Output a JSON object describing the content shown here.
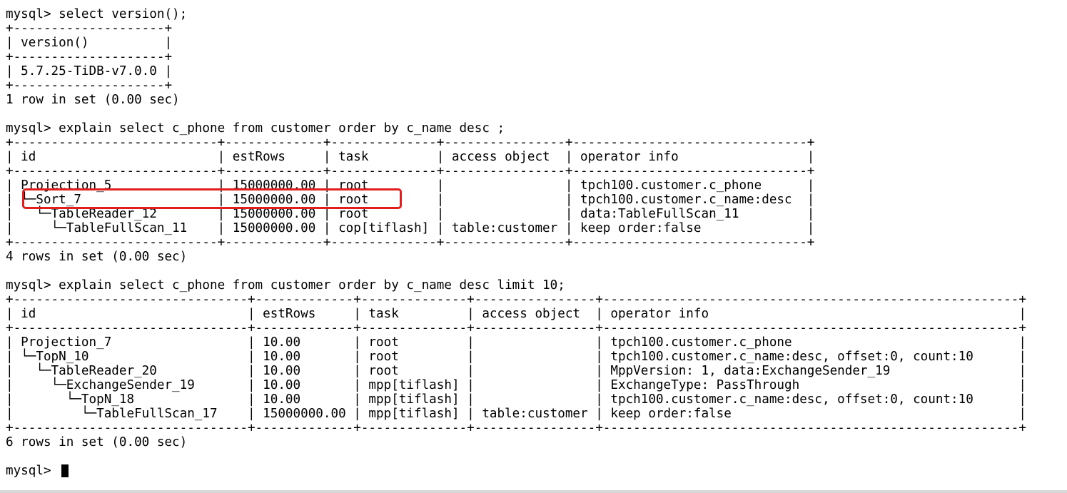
{
  "terminal": {
    "lines": [
      "mysql> select version();",
      "+--------------------+",
      "| version()          |",
      "+--------------------+",
      "| 5.7.25-TiDB-v7.0.0 |",
      "+--------------------+",
      "1 row in set (0.00 sec)",
      "",
      "mysql> explain select c_phone from customer order by c_name desc ;",
      "+---------------------------+-------------+--------------+----------------+-------------------------------+",
      "| id                        | estRows     | task         | access object  | operator info                 |",
      "+---------------------------+-------------+--------------+----------------+-------------------------------+",
      "| Projection_5              | 15000000.00 | root         |                | tpch100.customer.c_phone      |",
      "| └─Sort_7                  | 15000000.00 | root         |                | tpch100.customer.c_name:desc  |",
      "|   └─TableReader_12        | 15000000.00 | root         |                | data:TableFullScan_11         |",
      "|     └─TableFullScan_11    | 15000000.00 | cop[tiflash] | table:customer | keep order:false              |",
      "+---------------------------+-------------+--------------+----------------+-------------------------------+",
      "4 rows in set (0.00 sec)",
      "",
      "mysql> explain select c_phone from customer order by c_name desc limit 10;",
      "+-------------------------------+-------------+--------------+----------------+-------------------------------------------------------+",
      "| id                            | estRows     | task         | access object  | operator info                                         |",
      "+-------------------------------+-------------+--------------+----------------+-------------------------------------------------------+",
      "| Projection_7                  | 10.00       | root         |                | tpch100.customer.c_phone                              |",
      "| └─TopN_10                     | 10.00       | root         |                | tpch100.customer.c_name:desc, offset:0, count:10      |",
      "|   └─TableReader_20            | 10.00       | root         |                | MppVersion: 1, data:ExchangeSender_19                 |",
      "|     └─ExchangeSender_19       | 10.00       | mpp[tiflash] |                | ExchangeType: PassThrough                             |",
      "|       └─TopN_18               | 10.00       | mpp[tiflash] |                | tpch100.customer.c_name:desc, offset:0, count:10      |",
      "|         └─TableFullScan_17    | 15000000.00 | mpp[tiflash] | table:customer | keep order:false                                      |",
      "+-------------------------------+-------------+--------------+----------------+-------------------------------------------------------+",
      "6 rows in set (0.00 sec)",
      "",
      "mysql> "
    ]
  }
}
